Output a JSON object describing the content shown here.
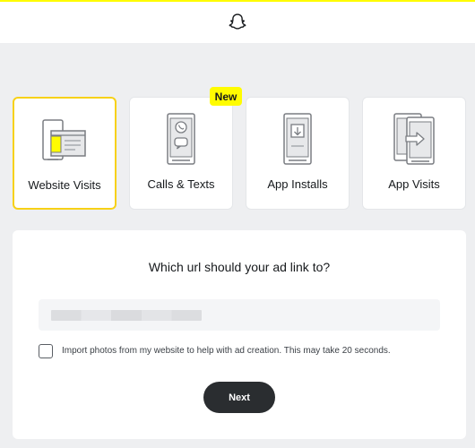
{
  "colors": {
    "brand_yellow": "#fffc00",
    "selected_border": "#f7d117",
    "page_bg": "#eeeff1",
    "button_dark": "#2a2d30"
  },
  "header": {
    "logo_icon": "snapchat-ghost-icon"
  },
  "goal_cards": [
    {
      "label": "Website Visits",
      "icon": "website-visits-icon",
      "selected": true
    },
    {
      "label": "Calls & Texts",
      "icon": "calls-texts-icon",
      "selected": false,
      "badge": "New"
    },
    {
      "label": "App Installs",
      "icon": "app-installs-icon",
      "selected": false
    },
    {
      "label": "App Visits",
      "icon": "app-visits-icon",
      "selected": false
    }
  ],
  "form": {
    "question": "Which url should your ad link to?",
    "url_value": "",
    "import_checked": false,
    "import_label": "Import photos from my website to help with ad creation. This may take 20 seconds.",
    "next_label": "Next"
  }
}
